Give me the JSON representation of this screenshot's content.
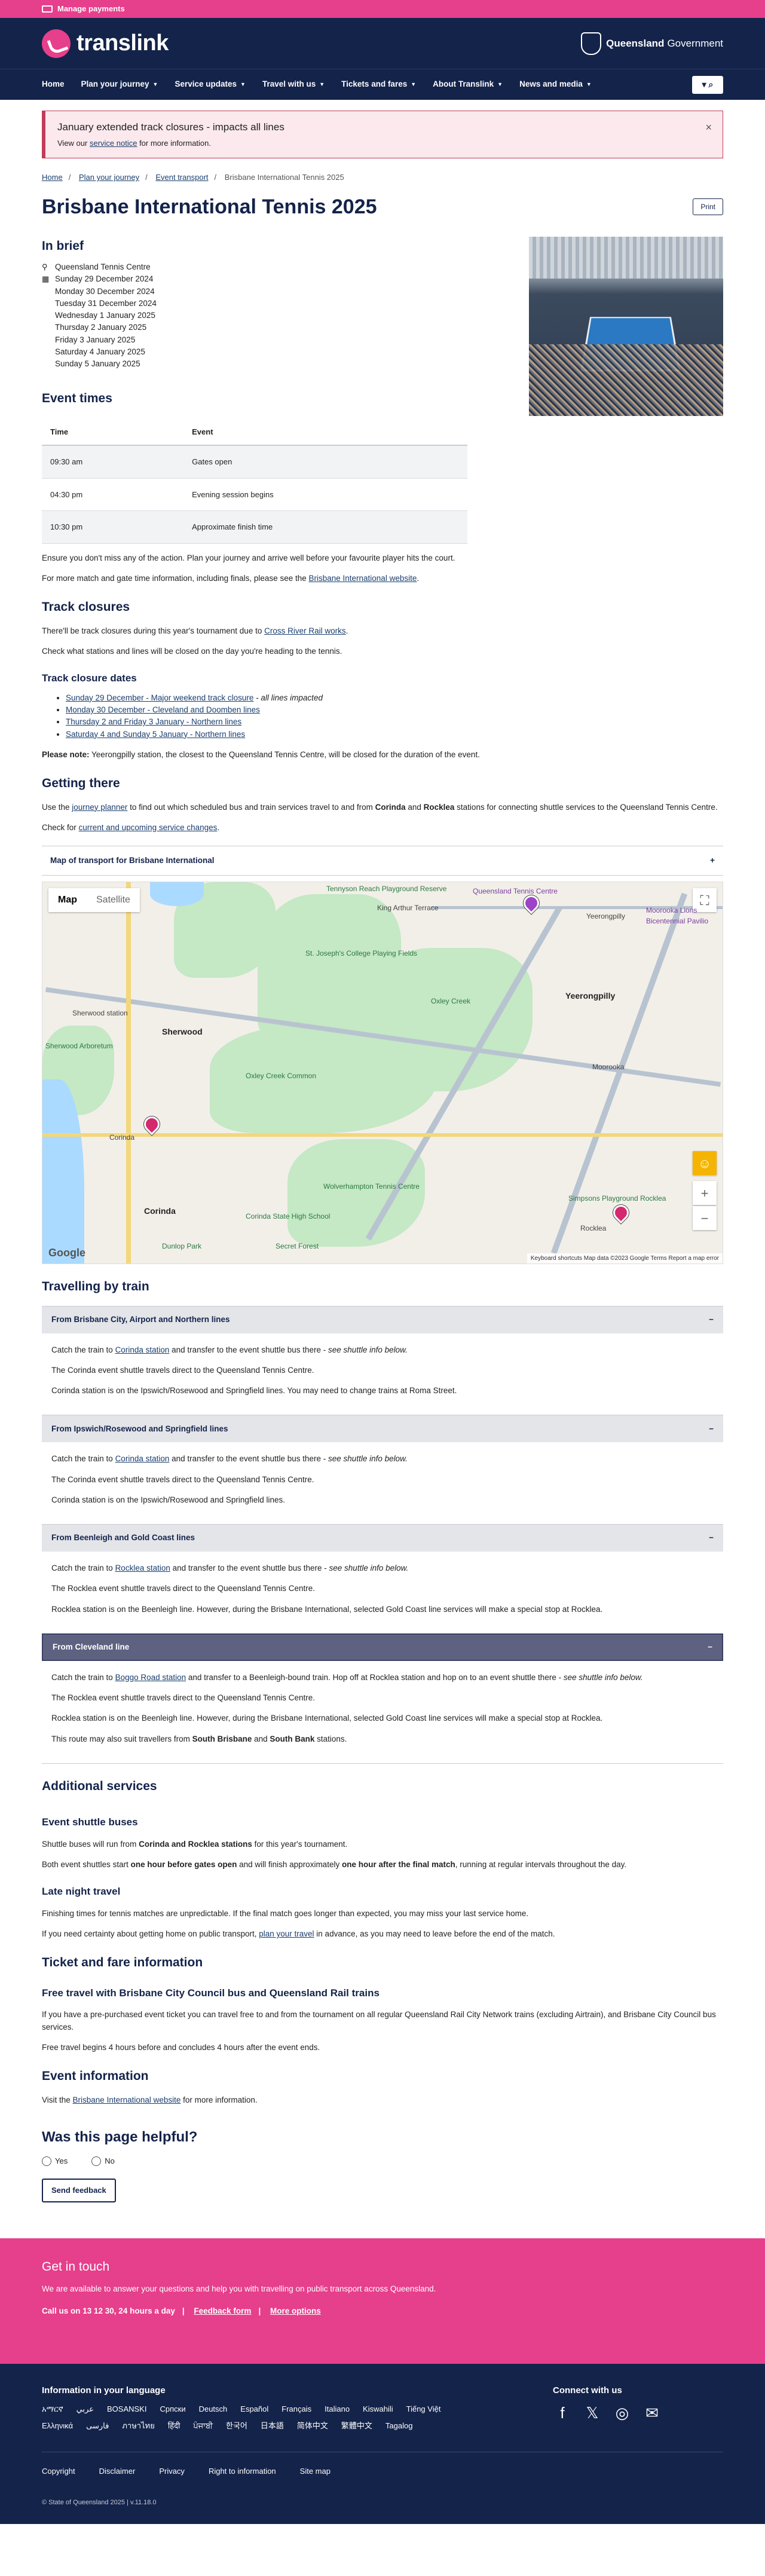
{
  "topbar": {
    "label": "Manage payments"
  },
  "header": {
    "logo": "translink",
    "gov_bold": "Queensland",
    "gov_text": "Government"
  },
  "nav": {
    "items": [
      "Home",
      "Plan your journey",
      "Service updates",
      "Travel with us",
      "Tickets and fares",
      "About Translink",
      "News and media"
    ],
    "search_icon": "search-icon"
  },
  "alert": {
    "title": "January extended track closures - impacts all lines",
    "text_pre": "View our ",
    "link": "service notice",
    "text_post": " for more information.",
    "close": "×"
  },
  "breadcrumbs": [
    "Home",
    "Plan your journey",
    "Event transport",
    "Brisbane International Tennis 2025"
  ],
  "page_title": "Brisbane International Tennis 2025",
  "print_label": "Print",
  "in_brief": {
    "heading": "In brief",
    "venue": "Queensland Tennis Centre",
    "dates": [
      "Sunday 29 December 2024",
      "Monday 30 December 2024",
      "Tuesday 31 December 2024",
      "Wednesday 1 January 2025",
      "Thursday 2 January 2025",
      "Friday 3 January 2025",
      "Saturday 4 January 2025",
      "Sunday 5 January 2025"
    ]
  },
  "event_times": {
    "heading": "Event times",
    "columns": [
      "Time",
      "Event"
    ],
    "rows": [
      [
        "09:30 am",
        "Gates open"
      ],
      [
        "04:30 pm",
        "Evening session begins"
      ],
      [
        "10:30 pm",
        "Approximate finish time"
      ]
    ]
  },
  "intro": {
    "p1": "Ensure you don't miss any of the action. Plan your journey and arrive well before your favourite player hits the court.",
    "p2_pre": "For more match and gate time information, including finals, please see the ",
    "p2_link": "Brisbane International website",
    "p2_post": "."
  },
  "track": {
    "heading": "Track closures",
    "p1_pre": "There'll be track closures during this year's tournament due to ",
    "p1_link": "Cross River Rail works",
    "p1_post": ".",
    "p2": "Check what stations and lines will be closed on the day you're heading to the tennis.",
    "dates_heading": "Track closure dates",
    "closures": [
      {
        "link": "Sunday 29 December - Major weekend track closure",
        "note": " - all lines impacted"
      },
      {
        "link": "Monday 30 December - Cleveland and Doomben lines",
        "note": ""
      },
      {
        "link": "Thursday 2 and Friday 3 January - Northern lines",
        "note": ""
      },
      {
        "link": "Saturday 4 and Sunday 5 January - Northern lines",
        "note": ""
      }
    ],
    "note_bold": "Please note:",
    "note_text": " Yeerongpilly station, the closest to the Queensland Tennis Centre, will be closed for the duration of the event."
  },
  "getting_there": {
    "heading": "Getting there",
    "p1_pre": "Use the ",
    "p1_link": "journey planner",
    "p1_mid": " to find out which scheduled bus and train services travel to and from ",
    "p1_b1": "Corinda",
    "p1_and": " and ",
    "p1_b2": "Rocklea",
    "p1_post": " stations for connecting shuttle services to the Queensland Tennis Centre.",
    "p2_pre": "Check for ",
    "p2_link": "current and upcoming service changes",
    "p2_post": ".",
    "map_toggle": "Map of transport for Brisbane International",
    "plus": "+"
  },
  "map": {
    "tab_map": "Map",
    "tab_sat": "Satellite",
    "labels": [
      "Tennyson Reach Playground Reserve",
      "King Arthur Terrace",
      "Queensland Tennis Centre",
      "Yeerongpilly",
      "Moorooka Lions Bicentennial Pavilio",
      "St. Joseph's College Playing Fields",
      "Oxley Creek",
      "Yeerongpilly",
      "Sherwood",
      "Sherwood station",
      "Sherwood Arboretum",
      "Oxley Creek Common",
      "Moorooka",
      "Corinda",
      "Corinda",
      "Corinda State High School",
      "Rocklea",
      "Secret Forest",
      "Dunlop Park",
      "Simpsons Playground Rocklea",
      "Wolverhampton Tennis Centre"
    ],
    "footer": "Keyboard shortcuts   Map data ©2023 Google   Terms   Report a map error",
    "google": "Google"
  },
  "by_train": {
    "heading": "Travelling by train",
    "sections": [
      {
        "title": "From Brisbane City, Airport and Northern lines",
        "dark": false,
        "p1_pre": "Catch the train to ",
        "p1_link": "Corinda station",
        "p1_mid": " and transfer to the event shuttle bus there - ",
        "p1_em": "see shuttle info below.",
        "p2": "The Corinda event shuttle travels direct to the Queensland Tennis Centre.",
        "p3": "Corinda station is on the Ipswich/Rosewood and Springfield lines. You may need to change trains at Roma Street.",
        "p4_pre": "",
        "p4_b1": "",
        "p4_and": "",
        "p4_b2": "",
        "p4_post": ""
      },
      {
        "title": "From Ipswich/Rosewood and Springfield lines",
        "dark": false,
        "p1_pre": "Catch the train to ",
        "p1_link": "Corinda station",
        "p1_mid": " and transfer to the event shuttle bus there - ",
        "p1_em": "see shuttle info below.",
        "p2": "The Corinda event shuttle travels direct to the Queensland Tennis Centre.",
        "p3": "Corinda station is on the Ipswich/Rosewood and Springfield lines.",
        "p4_pre": "",
        "p4_b1": "",
        "p4_and": "",
        "p4_b2": "",
        "p4_post": ""
      },
      {
        "title": "From Beenleigh and Gold Coast lines",
        "dark": false,
        "p1_pre": "Catch the train to ",
        "p1_link": "Rocklea station",
        "p1_mid": " and transfer to the event shuttle bus there - ",
        "p1_em": "see shuttle info below.",
        "p2": "The Rocklea event shuttle travels direct to the Queensland Tennis Centre.",
        "p3": "Rocklea station is on the Beenleigh line. However, during the Brisbane International, selected Gold Coast line services will make a special stop at Rocklea.",
        "p4_pre": "",
        "p4_b1": "",
        "p4_and": "",
        "p4_b2": "",
        "p4_post": ""
      },
      {
        "title": "From Cleveland line",
        "dark": true,
        "p1_pre": "Catch the train to ",
        "p1_link": "Boggo Road station",
        "p1_mid": " and transfer to a Beenleigh-bound train. Hop off at Rocklea station and hop on to an event shuttle there - ",
        "p1_em": "see shuttle info below.",
        "p2": "The Rocklea event shuttle travels direct to the Queensland Tennis Centre.",
        "p3": "Rocklea station is on the Beenleigh line. However, during the Brisbane International, selected Gold Coast line services will make a special stop at Rocklea.",
        "p4_pre": "This route may also suit travellers from ",
        "p4_b1": "South Brisbane",
        "p4_and": " and ",
        "p4_b2": "South Bank",
        "p4_post": " stations."
      }
    ],
    "minus": "−"
  },
  "additional": {
    "heading": "Additional services",
    "shuttle_heading": "Event shuttle buses",
    "s1_pre": "Shuttle buses will run from ",
    "s1_b": "Corinda and Rocklea stations",
    "s1_post": " for this year's tournament.",
    "s2_pre": "Both event shuttles start ",
    "s2_b1": "one hour before gates open",
    "s2_mid": " and will finish approximately ",
    "s2_b2": "one hour after the final match",
    "s2_post": ", running at regular intervals throughout the day.",
    "late_heading": "Late night travel",
    "l1": "Finishing times for tennis matches are unpredictable. If the final match goes longer than expected, you may miss your last service home.",
    "l2_pre": "If you need certainty about getting home on public transport, ",
    "l2_link": "plan your travel",
    "l2_post": " in advance, as you may need to leave before the end of the match.",
    "ticket_heading": "Ticket and fare information",
    "free_heading": "Free travel with Brisbane City Council bus and Queensland Rail trains",
    "f1": "If you have a pre-purchased event ticket you can travel free to and from the tournament on all regular Queensland Rail City Network trains (excluding Airtrain), and Brisbane City Council bus services.",
    "f2": "Free travel begins 4 hours before and concludes 4 hours after the event ends.",
    "info_heading": "Event information",
    "i1_pre": "Visit the ",
    "i1_link": "Brisbane International website",
    "i1_post": " for more information."
  },
  "feedback": {
    "heading": "Was this page helpful?",
    "yes": "Yes",
    "no": "No",
    "button": "Send feedback"
  },
  "get_in_touch": {
    "heading": "Get in touch",
    "text": "We are available to answer your questions and help you with travelling on public transport across Queensland.",
    "call": "Call us on 13 12 30, 24 hours a day",
    "form": "Feedback form",
    "more": "More options",
    "sep": "|"
  },
  "footer": {
    "lang_heading": "Information in your language",
    "langs": [
      "አማርኛ",
      "عربي",
      "BOSANSKI",
      "Српски",
      "Deutsch",
      "Español",
      "Français",
      "Italiano",
      "Kiswahili",
      "Tiếng Việt",
      "Ελληνικά",
      "فارسی",
      "ภาษาไทย",
      "हिंदी",
      "ਪੰਜਾਬੀ",
      "한국어",
      "日本語",
      "简体中文",
      "繁體中文",
      "Tagalog"
    ],
    "connect_heading": "Connect with us",
    "social": [
      "f",
      "𝕏",
      "◎",
      "✉"
    ],
    "links": [
      "Copyright",
      "Disclaimer",
      "Privacy",
      "Right to information",
      "Site map"
    ],
    "copyright": "© State of Queensland 2025  |  v.11.18.0"
  }
}
